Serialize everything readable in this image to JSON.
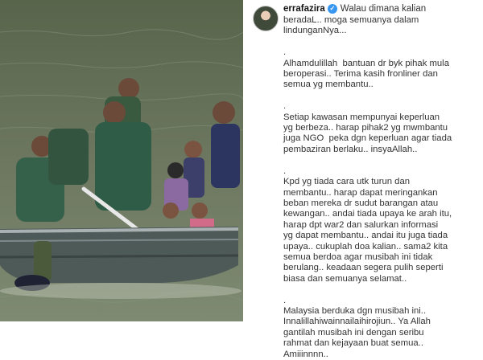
{
  "post": {
    "username": "errafazira",
    "verified_icon": "verified-badge-icon",
    "caption_first_line": "Walau dimana kalian",
    "caption_rest": "beradaL.. moga semuanya dalam\nlindunganNya...\n\n.\nAlhamdulillah  bantuan dr byk pihak mula\nberoperasi.. Terima kasih fronliner dan\nsemua yg membantu..\n\n.\nSetiap kawasan mempunyai keperluan\nyg berbeza.. harap pihak2 yg mwmbantu\njuga NGO  peka dgn keperluan agar tiada\npembaziran berlaku.. insyaAllah..\n\n.\nKpd yg tiada cara utk turun dan\nmembantu.. harap dapat meringankan\nbeban mereka dr sudut barangan atau\nkewangan.. andai tiada upaya ke arah itu,\nharap dpt war2 dan salurkan informasi\nyg dapat membantu.. andai itu juga tiada\nupaya.. cukuplah doa kalian.. sama2 kita\nsemua berdoa agar musibah ini tidak\nberulang.. keadaan segera pulih seperti\nbiasa dan semuanya selamat..\n\n.\nMalaysia berduka dgn musibah ini..\nInnalillahiwainnailaihirojiun.. Ya Allah\ngantilah musibah ini dengan seribu\nrahmat dan kejayaan buat semua..\nAmiiinnnn.."
  },
  "photo": {
    "description_icon": "flood-rescue-photo"
  },
  "colors": {
    "verified": "#3897f0",
    "water": "#6f7a5c",
    "boat": "#4d5a58"
  }
}
